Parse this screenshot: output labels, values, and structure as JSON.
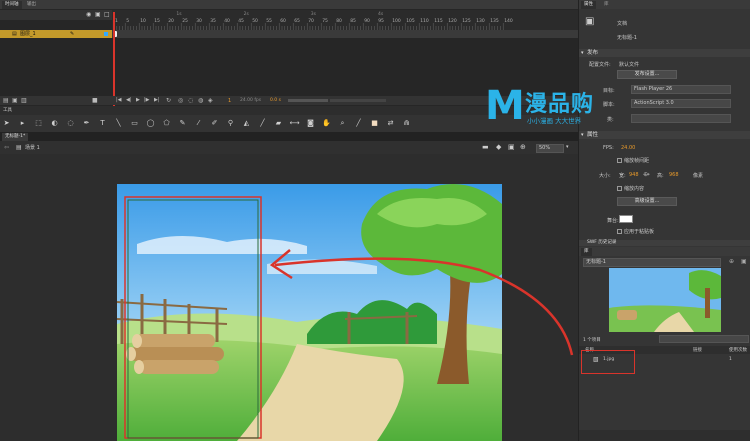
{
  "timeline": {
    "tabs": [
      "时间轴",
      "输出"
    ],
    "layer_name": "图层_1",
    "ruler_labels": [
      "1s",
      "2s",
      "3s",
      "4s"
    ],
    "frame_numbers": [
      "1",
      "5",
      "10",
      "15",
      "20",
      "25",
      "30",
      "35",
      "40",
      "45",
      "50",
      "55",
      "60",
      "65",
      "70",
      "75",
      "80",
      "85",
      "90",
      "95",
      "100",
      "105",
      "110",
      "115",
      "120",
      "125",
      "130",
      "135",
      "140"
    ],
    "fps_readout": "24.00 fps",
    "time_readout": "0.0 s",
    "frame_readout": "1"
  },
  "tools": {
    "panel_label": "工具",
    "icons": [
      "selection-icon",
      "subselection-icon",
      "free-transform-icon",
      "gradient-icon",
      "lasso-icon",
      "pen-icon",
      "text-icon",
      "line-icon",
      "rectangle-icon",
      "oval-icon",
      "polystar-icon",
      "pencil-icon",
      "brush-icon",
      "paint-brush-icon",
      "bone-icon",
      "paint-bucket-icon",
      "eyedropper-icon",
      "eraser-icon",
      "width-icon",
      "camera-icon",
      "hand-icon",
      "zoom-icon",
      "stroke-color-icon",
      "fill-color-icon",
      "swap-colors-icon",
      "snap-icon"
    ]
  },
  "stage": {
    "doc_tab": "无标题-1*",
    "scene_label": "场景 1",
    "zoom": "50%"
  },
  "properties": {
    "tabs": [
      "属性",
      "库"
    ],
    "doc_label": "文档",
    "doc_name": "无标题-1",
    "publish_section": "发布",
    "profile_label": "配置文件:",
    "profile_value": "默认文件",
    "publish_settings_button": "发布设置...",
    "target_label": "目标:",
    "target_value": "Flash Player 26",
    "script_label": "脚本:",
    "script_value": "ActionScript 3.0",
    "class_label": "类:",
    "props_section": "属性",
    "fps_label": "FPS:",
    "fps_value": "24.00",
    "scale_spans_label": "缩放帧间距",
    "size_label": "大小:",
    "width_label": "宽:",
    "width_value": "948",
    "height_label": "高:",
    "height_value": "968",
    "unit": "像素",
    "scale_content_label": "缩放内容",
    "advanced_button": "高级设置...",
    "stage_label": "舞台:",
    "apply_pasteboard_label": "应用于粘贴板",
    "swf_history_label": "SWF 历史记录"
  },
  "library": {
    "doc_select": "无标题-1",
    "item_count": "1 个项目",
    "col_name": "名称",
    "col_linkage": "链接",
    "col_use_count": "使用次数",
    "items": [
      {
        "name": "1.jpg",
        "use_count": "1"
      }
    ]
  },
  "watermark": {
    "logo_text": "漫品购",
    "slogan": "小小漫画 大大世界"
  },
  "colors": {
    "accent_red": "#d9342b",
    "timeline_layer": "#c49a2a",
    "fps_orange": "#e89a2b"
  }
}
